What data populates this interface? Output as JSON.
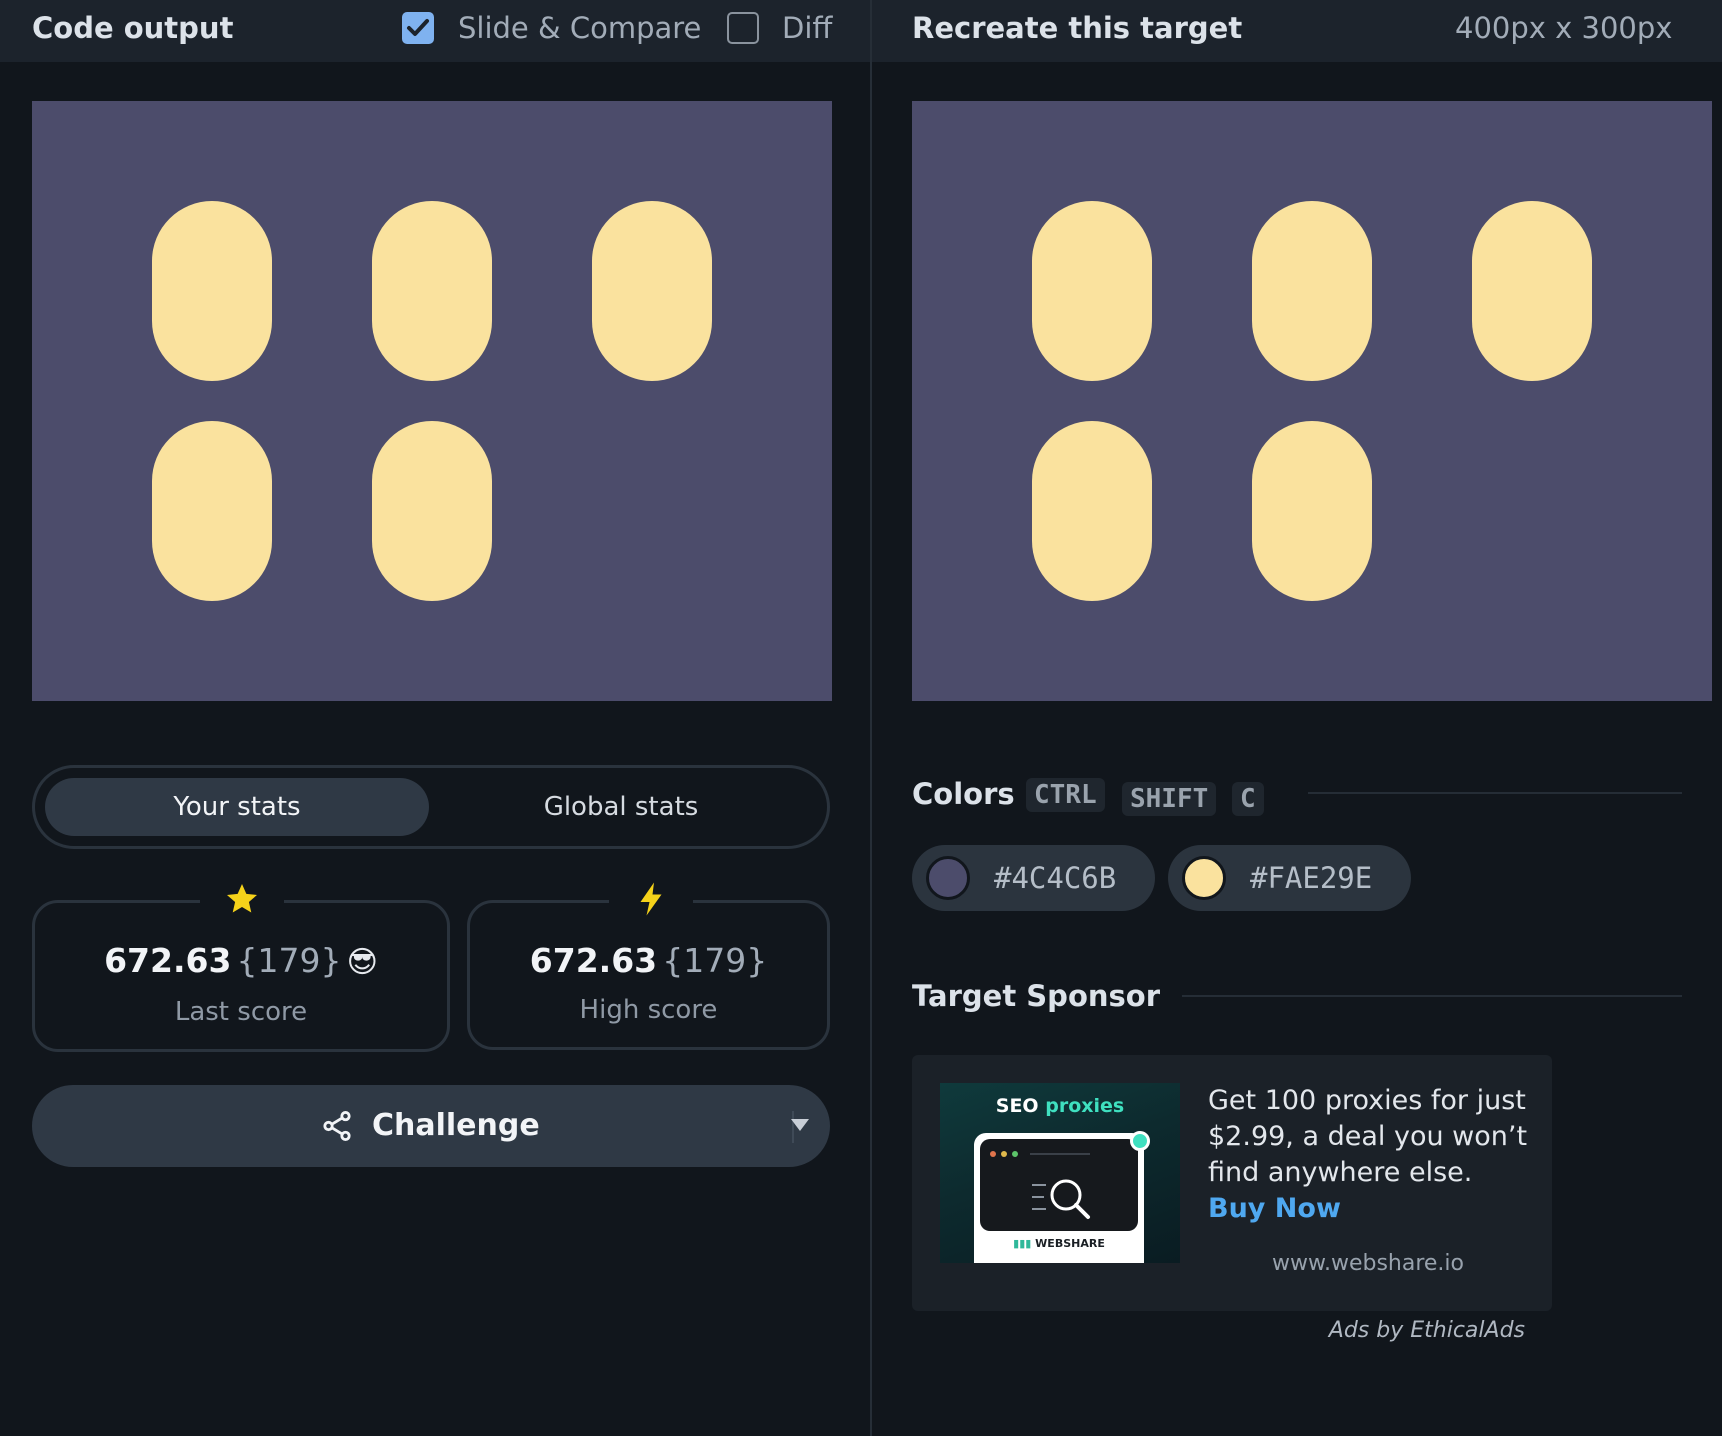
{
  "left_header": {
    "title": "Code output",
    "slide_compare_label": "Slide & Compare",
    "slide_compare_checked": true,
    "diff_label": "Diff",
    "diff_checked": false
  },
  "right_header": {
    "title": "Recreate this target",
    "dimensions": "400px x 300px"
  },
  "canvas": {
    "background": "#4C4C6B",
    "shape_color": "#FAE29E",
    "shape": "pill",
    "layout": "2 rows: 3 pills then 2 pills"
  },
  "stats_tabs": [
    {
      "label": "Your stats",
      "active": true
    },
    {
      "label": "Global stats",
      "active": false
    }
  ],
  "last_score": {
    "icon": "star-icon",
    "value": "672.63",
    "chars": "{179}",
    "emoji": "😎",
    "caption": "Last score"
  },
  "high_score": {
    "icon": "lightning-icon",
    "value": "672.63",
    "chars": "{179}",
    "caption": "High score"
  },
  "challenge": {
    "label": "Challenge",
    "icon": "share-icon"
  },
  "colors_section": {
    "title": "Colors",
    "shortcut": [
      "CTRL",
      "SHIFT",
      "C"
    ],
    "swatches": [
      {
        "hex": "#4C4C6B"
      },
      {
        "hex": "#FAE29E"
      }
    ]
  },
  "sponsor": {
    "title": "Target Sponsor",
    "image_headline_1": "SEO",
    "image_headline_2": "proxies",
    "image_brand": "WEBSHARE",
    "text": "Get 100 proxies for just $2.99, a deal you won’t find anywhere else.",
    "cta": "Buy Now",
    "url": "www.webshare.io",
    "footer": "Ads by EthicalAds"
  }
}
